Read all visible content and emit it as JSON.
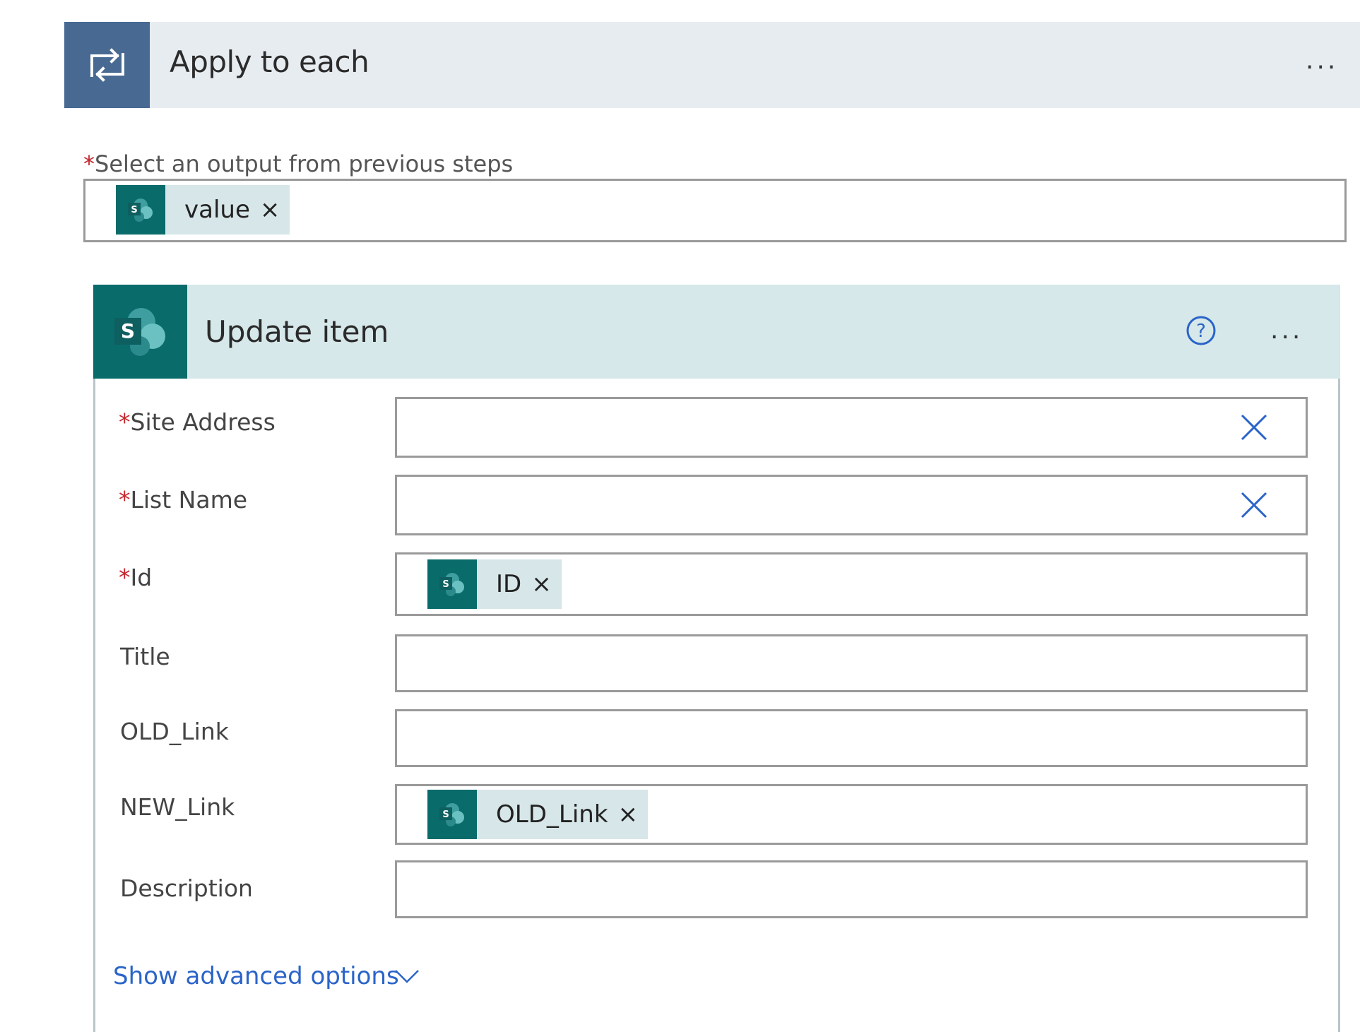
{
  "apply_to_each": {
    "title": "Apply to each",
    "more_label": "...",
    "select_label": "Select an output from previous steps",
    "required_mark": "*",
    "token": {
      "label": "value",
      "remove": "×"
    }
  },
  "update_item": {
    "title": "Update item",
    "more_label": "...",
    "help_icon": "question-circle-icon",
    "fields": {
      "site_address": {
        "label": "Site Address",
        "required": "*"
      },
      "list_name": {
        "label": "List Name",
        "required": "*"
      },
      "id": {
        "label": "Id",
        "required": "*",
        "token": {
          "label": "ID",
          "remove": "×"
        }
      },
      "title": {
        "label": "Title"
      },
      "old_link": {
        "label": "OLD_Link"
      },
      "new_link": {
        "label": "NEW_Link",
        "token": {
          "label": "OLD_Link",
          "remove": "×"
        }
      },
      "description": {
        "label": "Description"
      }
    },
    "advanced_options": "Show advanced options"
  },
  "colors": {
    "loop_accent": "#486991",
    "sharepoint_accent": "#0a6b6b",
    "required": "#c4262e",
    "link": "#2a64c8"
  }
}
